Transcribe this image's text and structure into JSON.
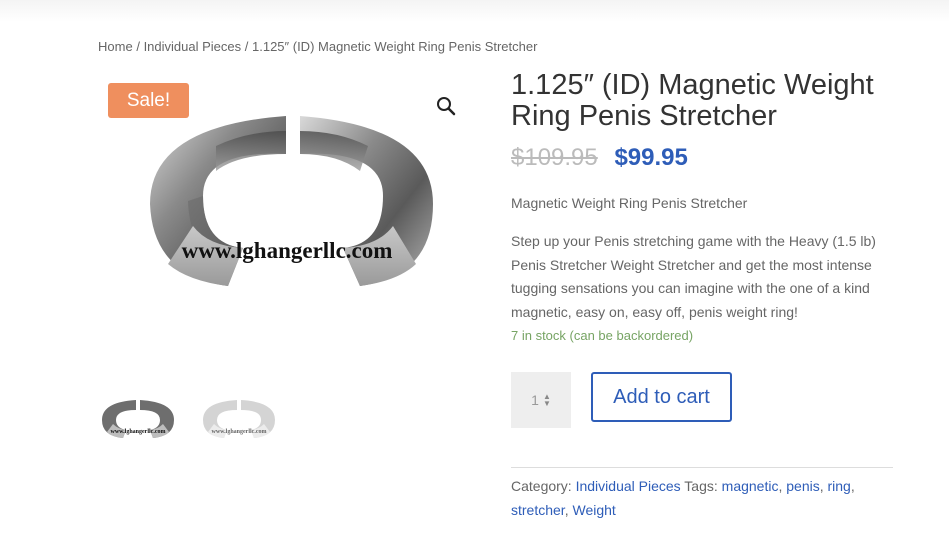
{
  "breadcrumb": {
    "home": "Home",
    "separator": "/",
    "category": "Individual Pieces",
    "current": "1.125″ (ID) Magnetic Weight Ring Penis Stretcher"
  },
  "gallery": {
    "sale_badge": "Sale!",
    "zoom_icon": "magnifier-icon",
    "watermark": "www.lghangerllc.com",
    "thumbnails": [
      {
        "name": "silver-ring-thumbnail",
        "watermark": "www.lghangerllc.com"
      },
      {
        "name": "light-ring-thumbnail",
        "watermark": "www.lghangerllc.com"
      }
    ]
  },
  "product": {
    "title": "1.125″ (ID) Magnetic Weight Ring Penis Stretcher",
    "price_old": "$109.95",
    "price_new": "$99.95",
    "short_description": "Magnetic Weight Ring Penis Stretcher",
    "description": "Step up your Penis stretching game with the Heavy (1.5 lb) Penis Stretcher Weight Stretcher and get the most intense tugging sensations you can imagine with the one of a kind magnetic, easy on, easy off, penis weight ring!",
    "stock": "7 in stock (can be backordered)",
    "quantity": "1",
    "add_to_cart": "Add to cart"
  },
  "meta": {
    "category_label": "Category:",
    "category": "Individual Pieces",
    "tags_label": "Tags:",
    "tags": [
      "magnetic",
      "penis",
      "ring",
      "stretcher",
      "Weight"
    ],
    "tag_sep": ","
  },
  "colors": {
    "accent": "#2e5db8",
    "sale": "#ef8f5e",
    "stock": "#77a464"
  }
}
